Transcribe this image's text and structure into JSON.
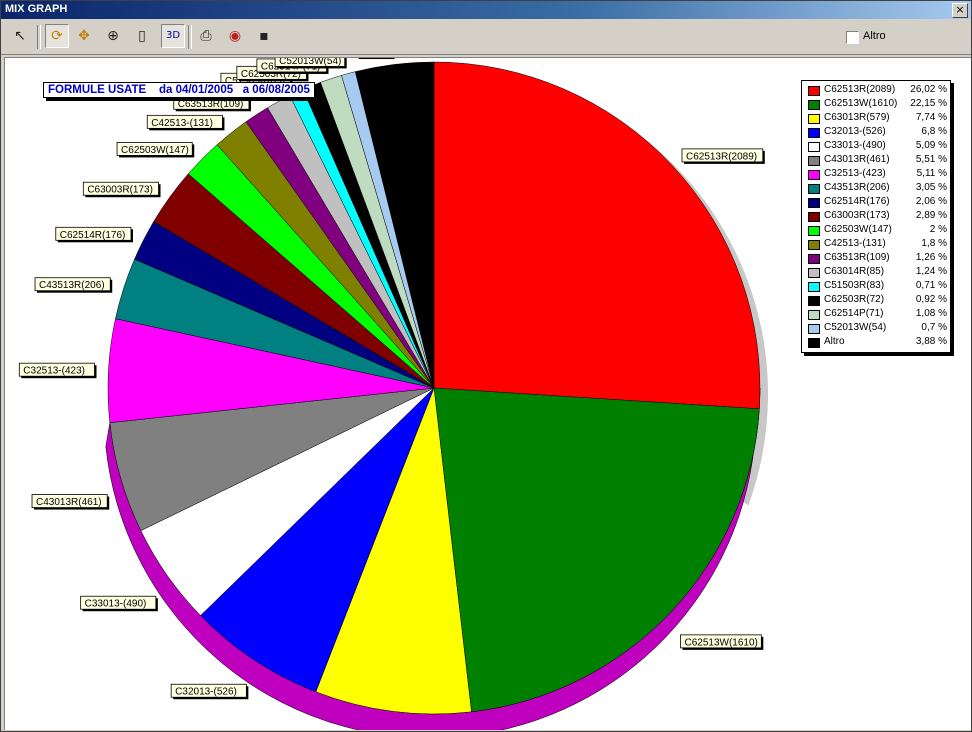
{
  "window": {
    "title": "MIX GRAPH",
    "close_glyph": "×"
  },
  "toolbar": {
    "items": [
      {
        "name": "pointer-icon",
        "glyph": "↖"
      },
      {
        "name": "rotate-icon",
        "glyph": "⟳"
      },
      {
        "name": "move-icon",
        "glyph": "✥"
      },
      {
        "name": "zoom-icon",
        "glyph": "⊕"
      },
      {
        "name": "page-icon",
        "glyph": "▯"
      },
      {
        "name": "3d-toggle",
        "glyph": "3D"
      },
      {
        "name": "print-icon",
        "glyph": "⎙"
      },
      {
        "name": "palette-icon",
        "glyph": "◉"
      },
      {
        "name": "save-icon",
        "glyph": "▪"
      }
    ],
    "checkbox_label": "Altro",
    "checkbox_checked": false
  },
  "chart_data": {
    "type": "pie",
    "title": "FORMULE USATE    da 04/01/2005   a 06/08/2005",
    "slices": [
      {
        "label": "C62513R(2089)",
        "value": 26.02,
        "pct": "26,02 %",
        "color": "#ff0000"
      },
      {
        "label": "C62513W(1610)",
        "value": 22.15,
        "pct": "22,15 %",
        "color": "#008000"
      },
      {
        "label": "C63013R(579)",
        "value": 7.74,
        "pct": "7,74 %",
        "color": "#ffff00"
      },
      {
        "label": "C32013-(526)",
        "value": 6.8,
        "pct": "6,8 %",
        "color": "#0000ff"
      },
      {
        "label": "C33013-(490)",
        "value": 5.09,
        "pct": "5,09 %",
        "color": "#ffffff"
      },
      {
        "label": "C43013R(461)",
        "value": 5.51,
        "pct": "5,51 %",
        "color": "#808080"
      },
      {
        "label": "C32513-(423)",
        "value": 5.11,
        "pct": "5,11 %",
        "color": "#ff00ff"
      },
      {
        "label": "C43513R(206)",
        "value": 3.05,
        "pct": "3,05 %",
        "color": "#008080"
      },
      {
        "label": "C62514R(176)",
        "value": 2.06,
        "pct": "2,06 %",
        "color": "#000080"
      },
      {
        "label": "C63003R(173)",
        "value": 2.89,
        "pct": "2,89 %",
        "color": "#800000"
      },
      {
        "label": "C62503W(147)",
        "value": 2,
        "pct": "2 %",
        "color": "#00ff00"
      },
      {
        "label": "C42513-(131)",
        "value": 1.8,
        "pct": "1,8 %",
        "color": "#808000"
      },
      {
        "label": "C63513R(109)",
        "value": 1.26,
        "pct": "1,26 %",
        "color": "#800080"
      },
      {
        "label": "C63014R(85)",
        "value": 1.24,
        "pct": "1,24 %",
        "color": "#c0c0c0"
      },
      {
        "label": "C51503R(83)",
        "value": 0.71,
        "pct": "0,71 %",
        "color": "#00ffff"
      },
      {
        "label": "C62503R(72)",
        "value": 0.92,
        "pct": "0,92 %",
        "color": "#000000"
      },
      {
        "label": "C62514P(71)",
        "value": 1.08,
        "pct": "1,08 %",
        "color": "#c0dcc0"
      },
      {
        "label": "C52013W(54)",
        "value": 0.7,
        "pct": "0,7 %",
        "color": "#a6caf0"
      },
      {
        "label": "Altro",
        "value": 3.88,
        "pct": "3,88 %",
        "color": "#000000"
      }
    ],
    "legend_position": "top-right",
    "view": "3d"
  }
}
